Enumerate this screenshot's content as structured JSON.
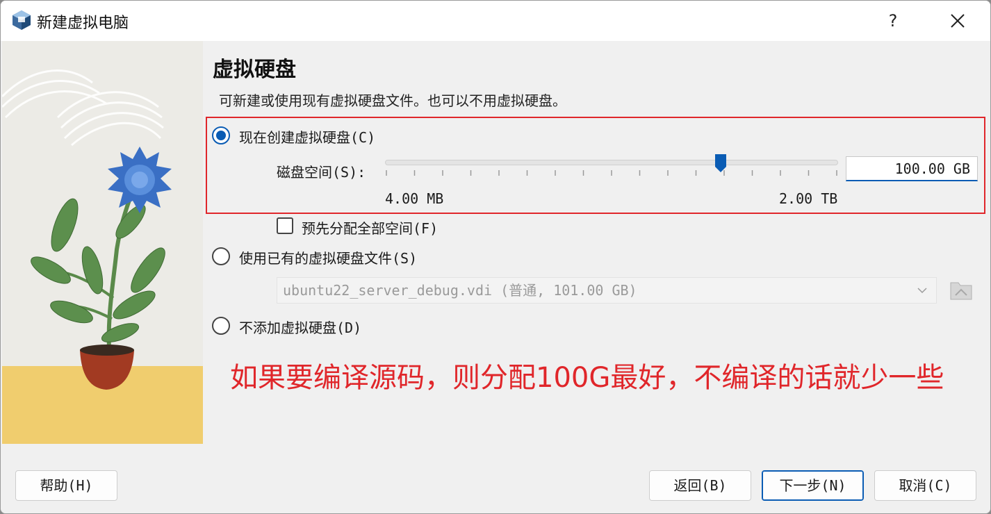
{
  "window": {
    "title": "新建虚拟电脑",
    "help_label": "?"
  },
  "page": {
    "heading": "虚拟硬盘",
    "description": "可新建或使用现有虚拟硬盘文件。也可以不用虚拟硬盘。"
  },
  "options": {
    "create_new": {
      "label": "现在创建虚拟硬盘(C)",
      "checked": true
    },
    "disk_size_label": "磁盘空间(S):",
    "disk_size_value": "100.00 GB",
    "slider_min_label": "4.00 MB",
    "slider_max_label": "2.00 TB",
    "slider_level": 0.75,
    "preallocate": {
      "label": "预先分配全部空间(F)",
      "checked": false
    },
    "use_existing": {
      "label": "使用已有的虚拟硬盘文件(S)",
      "checked": false
    },
    "existing_file": "ubuntu22_server_debug.vdi (普通, 101.00 GB)",
    "no_disk": {
      "label": "不添加虚拟硬盘(D)",
      "checked": false
    }
  },
  "annotation": "如果要编译源码，则分配100G最好，不编译的话就少一些",
  "footer": {
    "help": "帮助(H)",
    "back": "返回(B)",
    "next": "下一步(N)",
    "cancel": "取消(C)"
  },
  "colors": {
    "accent": "#0a5cb4",
    "annotation": "#e0262a"
  }
}
